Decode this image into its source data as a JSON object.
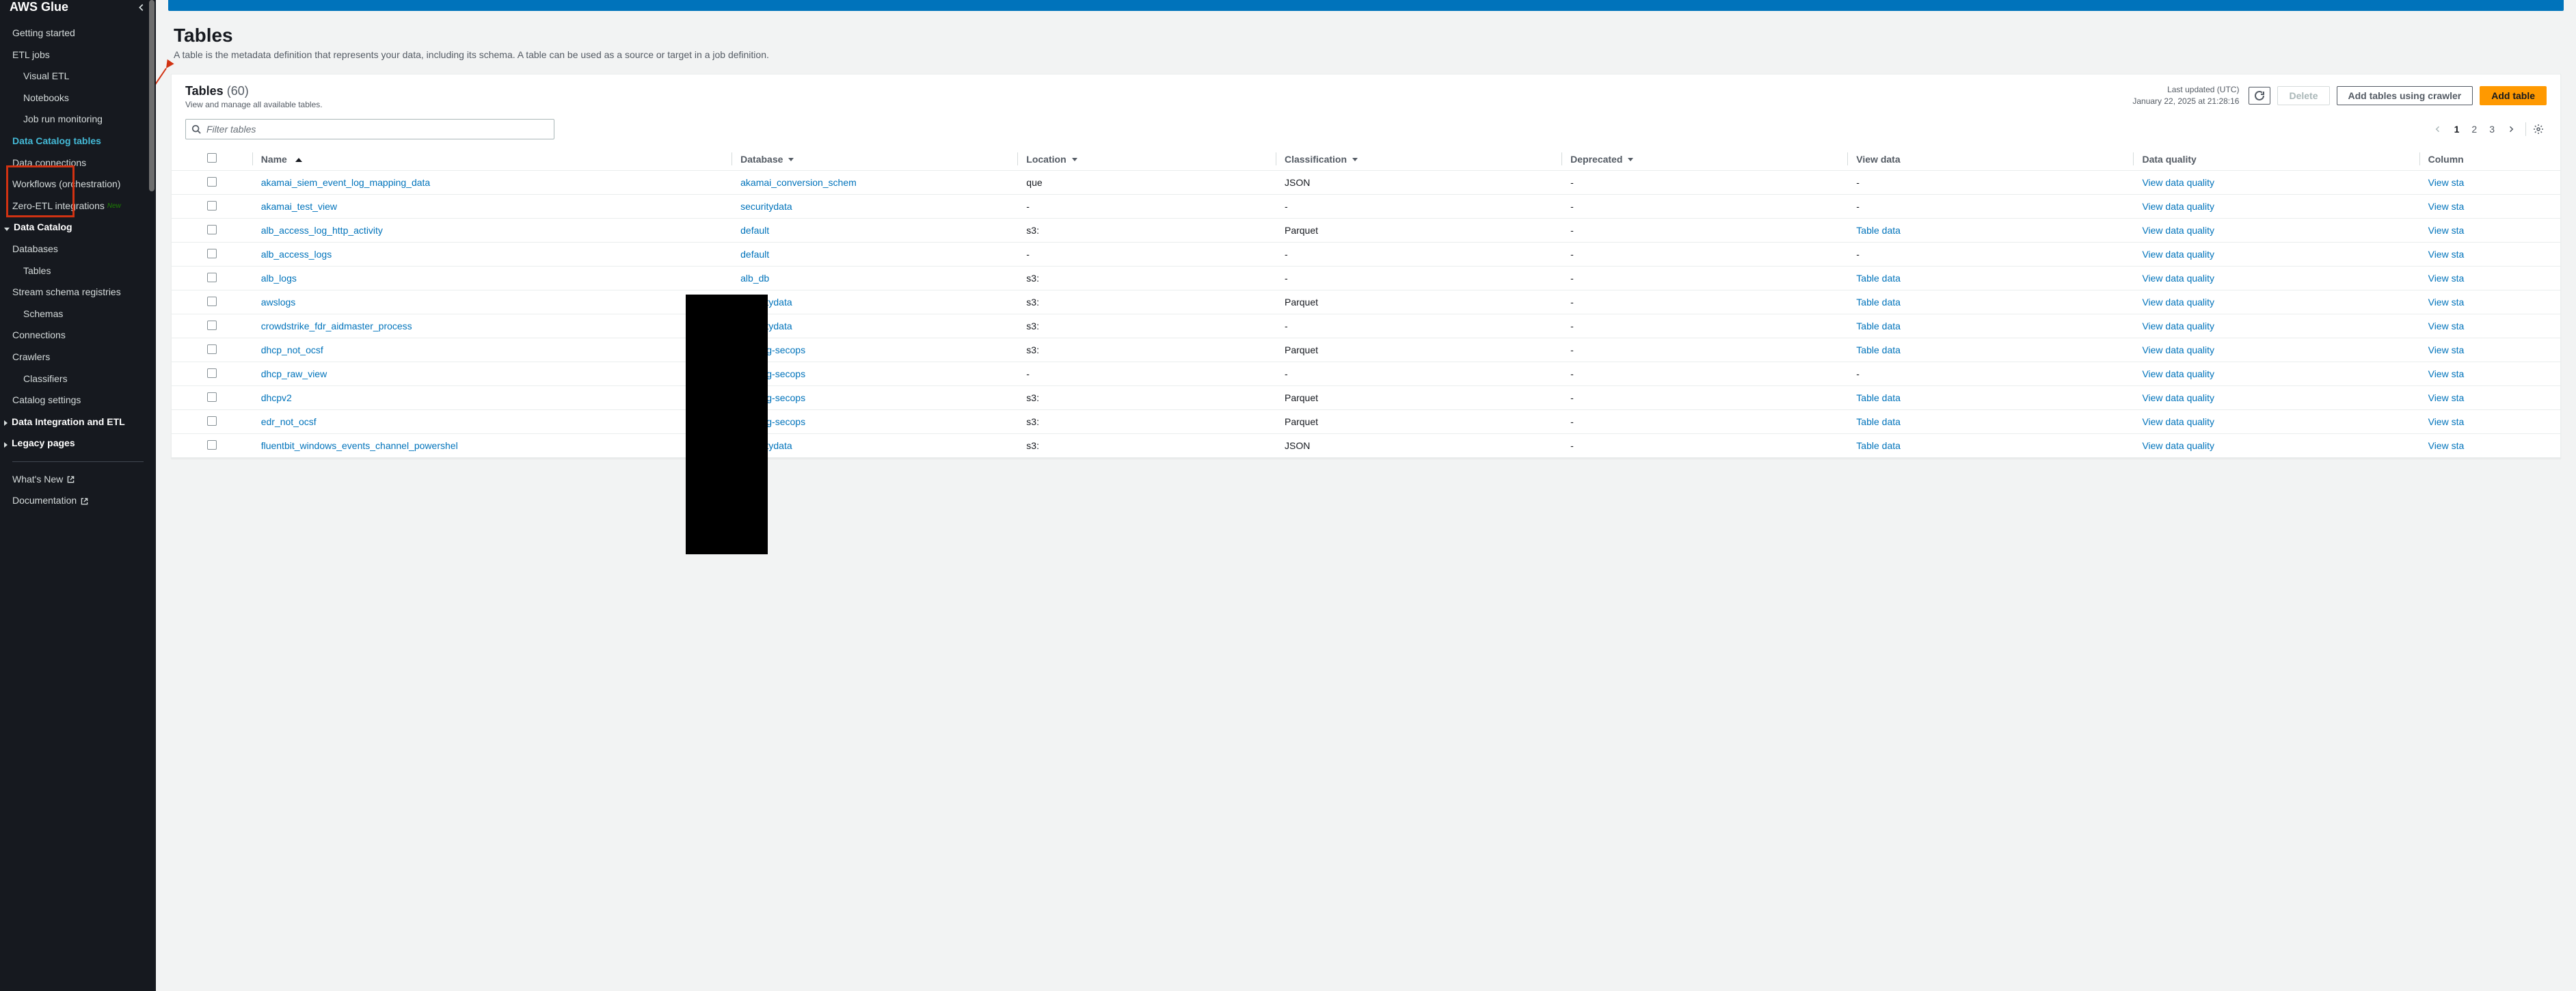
{
  "sidebar": {
    "title": "AWS Glue",
    "items": [
      {
        "label": "Getting started",
        "indent": 0
      },
      {
        "label": "ETL jobs",
        "indent": 0
      },
      {
        "label": "Visual ETL",
        "indent": 1
      },
      {
        "label": "Notebooks",
        "indent": 1
      },
      {
        "label": "Job run monitoring",
        "indent": 1
      },
      {
        "label": "Data Catalog tables",
        "indent": 0,
        "active": true
      },
      {
        "label": "Data connections",
        "indent": 0
      },
      {
        "label": "Workflows (orchestration)",
        "indent": 0
      },
      {
        "label": "Zero-ETL integrations",
        "indent": 0,
        "badge": "New"
      }
    ],
    "catalog": {
      "header": "Data Catalog",
      "items": [
        {
          "label": "Databases"
        },
        {
          "label": "Tables"
        },
        {
          "label": "Stream schema registries"
        },
        {
          "label": "Schemas",
          "indent": 1
        },
        {
          "label": "Connections"
        },
        {
          "label": "Crawlers"
        },
        {
          "label": "Classifiers",
          "indent": 1
        },
        {
          "label": "Catalog settings"
        }
      ]
    },
    "integration": "Data Integration and ETL",
    "legacy": "Legacy pages",
    "footer": [
      {
        "label": "What's New"
      },
      {
        "label": "Documentation"
      }
    ]
  },
  "header": {
    "title": "Tables",
    "desc": "A table is the metadata definition that represents your data, including its schema. A table can be used as a source or target in a job definition."
  },
  "panel": {
    "title": "Tables",
    "count": "(60)",
    "subtitle": "View and manage all available tables.",
    "last_updated_label": "Last updated (UTC)",
    "last_updated_value": "January 22, 2025 at 21:28:16",
    "delete": "Delete",
    "add_crawler": "Add tables using crawler",
    "add_table": "Add table"
  },
  "search": {
    "placeholder": "Filter tables"
  },
  "pager": {
    "pages": [
      "1",
      "2",
      "3"
    ]
  },
  "columns": {
    "name": "Name",
    "database": "Database",
    "location": "Location",
    "classification": "Classification",
    "deprecated": "Deprecated",
    "view_data": "View data",
    "data_quality": "Data quality",
    "column": "Column"
  },
  "rows": [
    {
      "name": "akamai_siem_event_log_mapping_data",
      "db": "akamai_conversion_schem",
      "loc": "que",
      "class": "JSON",
      "dep": "-",
      "vd": "-",
      "dq": "View data quality",
      "cols": "View sta"
    },
    {
      "name": "akamai_test_view",
      "db": "securitydata",
      "loc": "-",
      "class": "-",
      "dep": "-",
      "vd": "-",
      "dq": "View data quality",
      "cols": "View sta"
    },
    {
      "name": "alb_access_log_http_activity",
      "db": "default",
      "loc": "s3:",
      "class": "Parquet",
      "dep": "-",
      "vd": "Table data",
      "dq": "View data quality",
      "cols": "View sta"
    },
    {
      "name": "alb_access_logs",
      "db": "default",
      "loc": "-",
      "class": "-",
      "dep": "-",
      "vd": "-",
      "dq": "View data quality",
      "cols": "View sta"
    },
    {
      "name": "alb_logs",
      "db": "alb_db",
      "loc": "s3:",
      "class": "-",
      "dep": "-",
      "vd": "Table data",
      "dq": "View data quality",
      "cols": "View sta"
    },
    {
      "name": "awslogs",
      "db": "securitydata",
      "loc": "s3:",
      "class": "Parquet",
      "dep": "-",
      "vd": "Table data",
      "dq": "View data quality",
      "cols": "View sta"
    },
    {
      "name": "crowdstrike_fdr_aidmaster_process",
      "db": "securitydata",
      "loc": "s3:",
      "class": "-",
      "dep": "-",
      "vd": "Table data",
      "dq": "View data quality",
      "cols": "View sta"
    },
    {
      "name": "dhcp_not_ocsf",
      "db": "iceberg-secops",
      "loc": "s3:",
      "class": "Parquet",
      "dep": "-",
      "vd": "Table data",
      "dq": "View data quality",
      "cols": "View sta"
    },
    {
      "name": "dhcp_raw_view",
      "db": "iceberg-secops",
      "loc": "-",
      "class": "-",
      "dep": "-",
      "vd": "-",
      "dq": "View data quality",
      "cols": "View sta"
    },
    {
      "name": "dhcpv2",
      "db": "iceberg-secops",
      "loc": "s3:",
      "class": "Parquet",
      "dep": "-",
      "vd": "Table data",
      "dq": "View data quality",
      "cols": "View sta"
    },
    {
      "name": "edr_not_ocsf",
      "db": "iceberg-secops",
      "loc": "s3:",
      "class": "Parquet",
      "dep": "-",
      "vd": "Table data",
      "dq": "View data quality",
      "cols": "View sta"
    },
    {
      "name": "fluentbit_windows_events_channel_powershel",
      "db": "securitydata",
      "loc": "s3:",
      "class": "JSON",
      "dep": "-",
      "vd": "Table data",
      "dq": "View data quality",
      "cols": "View sta"
    }
  ]
}
